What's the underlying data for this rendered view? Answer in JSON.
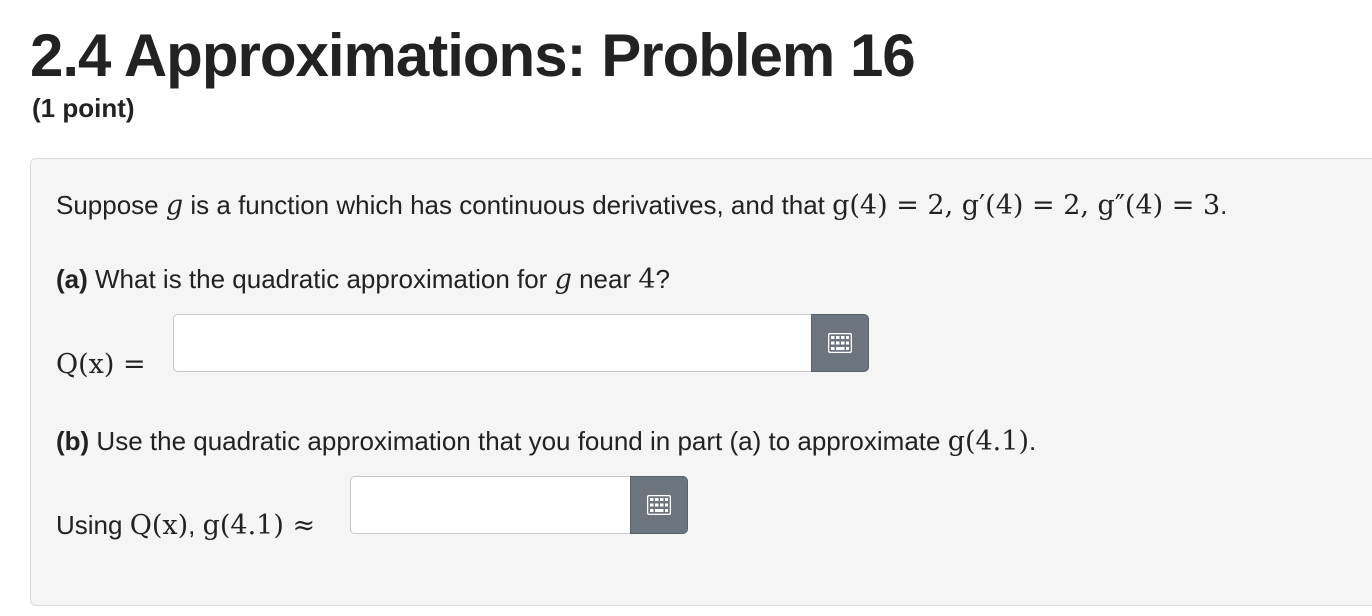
{
  "header": {
    "title": "2.4 Approximations: Problem 16",
    "points": "(1 point)"
  },
  "problem": {
    "intro": {
      "t1": "Suppose ",
      "g": "g",
      "t2": " is a function which has continuous derivatives, and that ",
      "given": "g(4) = 2, g′(4) = 2, g″(4) = 3",
      "t3": "."
    },
    "part_a": {
      "label": "(a)",
      "t1": " What is the quadratic approximation for ",
      "g": "g",
      "t2": " near ",
      "n": "4",
      "t3": "?",
      "answer_label": "Q(x) =",
      "answer_value": "",
      "equation_button_icon": "equation-editor-grid-icon"
    },
    "part_b": {
      "label": "(b)",
      "t1": " Use the quadratic approximation that you found in part (a) to approximate ",
      "expr": "g(4.1)",
      "t2": ".",
      "using": "Using ",
      "q": "Q(x)",
      "comma": ", ",
      "approx": "g(4.1) ≈",
      "answer_value": "",
      "equation_button_icon": "equation-editor-grid-icon"
    }
  }
}
